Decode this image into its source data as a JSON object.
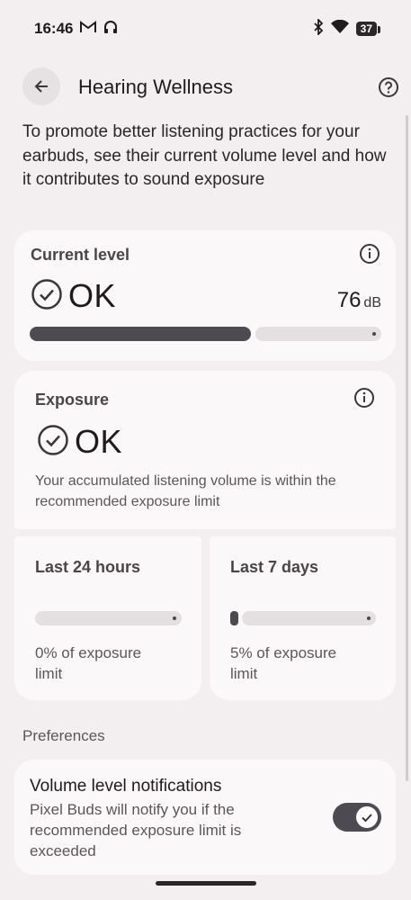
{
  "status_bar": {
    "time": "16:46",
    "battery": "37",
    "icons": [
      "gmail-icon",
      "headphones-icon",
      "bluetooth-icon",
      "wifi-icon",
      "battery-icon"
    ]
  },
  "app_bar": {
    "title": "Hearing Wellness",
    "back_icon": "back-arrow-icon",
    "help_icon": "help-icon"
  },
  "intro": "To promote better listening practices for your earbuds, see their current volume level and how it contributes to sound exposure",
  "current_level": {
    "title": "Current level",
    "status": "OK",
    "value": "76",
    "unit": "dB",
    "fill_fraction": 0.63
  },
  "exposure": {
    "title": "Exposure",
    "status": "OK",
    "description": "Your accumulated listening volume is within the recommended exposure limit"
  },
  "last_24h": {
    "title": "Last 24 hours",
    "caption": "0% of exposure limit",
    "fill_fraction": 0
  },
  "last_7d": {
    "title": "Last 7 days",
    "caption": "5% of exposure limit",
    "fill_fraction": 0.05
  },
  "preferences": {
    "label": "Preferences",
    "notif_title": "Volume level notifications",
    "notif_desc": "Pixel Buds will notify you if the recommended exposure limit is exceeded",
    "notif_enabled": true
  },
  "colors": {
    "background": "#f3eff0",
    "card": "#fbf8f9",
    "accent": "#4d4a52",
    "track": "#e4dfe1"
  }
}
